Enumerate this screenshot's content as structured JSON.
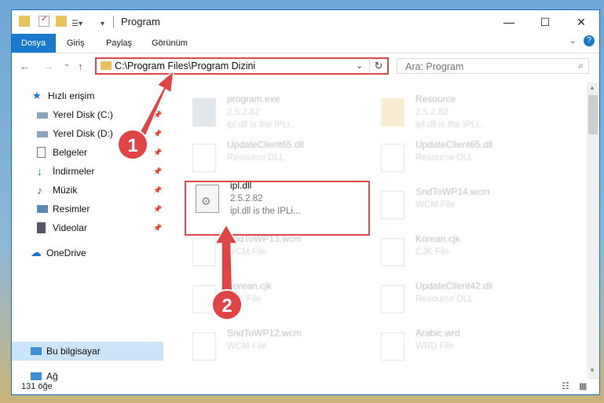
{
  "window": {
    "title": "Program",
    "minimize_glyph": "—",
    "maximize_glyph": "☐",
    "close_glyph": "✕"
  },
  "ribbon": {
    "tabs": [
      "Dosya",
      "Giriş",
      "Paylaş",
      "Görünüm"
    ],
    "help_glyph": "?"
  },
  "nav": {
    "back": "←",
    "forward": "→",
    "recent": "⌄",
    "up": "↑",
    "address": "C:\\Program Files\\Program Dizini",
    "search_placeholder": "Ara: Program"
  },
  "sidebar": {
    "items": [
      {
        "label": "Hızlı erişim",
        "icon": "star-icon"
      },
      {
        "label": "Yerel Disk (C:)",
        "icon": "drive-icon"
      },
      {
        "label": "Yerel Disk (D:)",
        "icon": "drive-icon"
      },
      {
        "label": "Belgeler",
        "icon": "documents-icon"
      },
      {
        "label": "İndirmeler",
        "icon": "download-icon"
      },
      {
        "label": "Müzik",
        "icon": "music-icon"
      },
      {
        "label": "Resimler",
        "icon": "pictures-icon"
      },
      {
        "label": "Videolar",
        "icon": "videos-icon"
      },
      {
        "label": "OneDrive",
        "icon": "cloud-icon"
      },
      {
        "label": "Bu bilgisayar",
        "icon": "computer-icon"
      },
      {
        "label": "Ağ",
        "icon": "network-icon"
      }
    ]
  },
  "files": [
    {
      "name": "program.exe",
      "line2": "2.5.2.82",
      "line3": "ipl.dll is the IPLi..."
    },
    {
      "name": "Resource",
      "line2": "2.5.2.82",
      "line3": "ipl.dll is the IPLi..."
    },
    {
      "name": "UpdateClient65.dll",
      "line2": "Resource DLL",
      "line3": ""
    },
    {
      "name": "UpdateClient65.dll",
      "line2": "Resource DLL",
      "line3": ""
    },
    {
      "name": "ipl.dll",
      "line2": "2.5.2.82",
      "line3": "ipl.dll is the IPLi..."
    },
    {
      "name": "SndToWP14.wcm",
      "line2": "WCM File",
      "line3": ""
    },
    {
      "name": "SndToWP13.wcm",
      "line2": "WCM File",
      "line3": ""
    },
    {
      "name": "Korean.cjk",
      "line2": "CJK File",
      "line3": ""
    },
    {
      "name": "Korean.cjk",
      "line2": "CJK File",
      "line3": ""
    },
    {
      "name": "UpdateClient42.dll",
      "line2": "Resource DLL",
      "line3": ""
    },
    {
      "name": "SndToWP12.wcm",
      "line2": "WCM File",
      "line3": ""
    },
    {
      "name": "Arabic.wrd",
      "line2": "WRD File",
      "line3": ""
    }
  ],
  "status": {
    "count": "131 öğe"
  },
  "annotations": {
    "step1": "1",
    "step2": "2"
  },
  "colors": {
    "accent": "#1979ca",
    "highlight": "#e04a4a",
    "selected": "#cce4f7"
  }
}
